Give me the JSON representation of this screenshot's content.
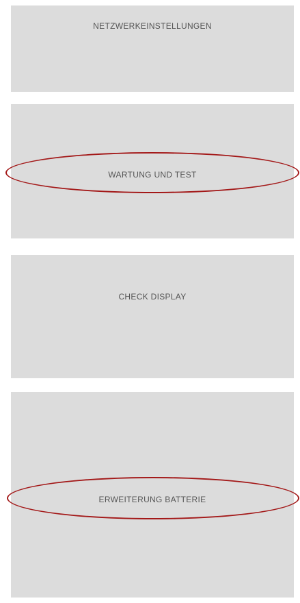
{
  "menu": {
    "items": [
      {
        "label": "NETZWERKEINSTELLUNGEN",
        "highlighted": false
      },
      {
        "label": "WARTUNG UND TEST",
        "highlighted": true
      },
      {
        "label": "CHECK DISPLAY",
        "highlighted": false
      },
      {
        "label": "ERWEITERUNG BATTERIE",
        "highlighted": true
      }
    ]
  },
  "colors": {
    "tile_background": "#dcdcdc",
    "label_text": "#555555",
    "highlight_ring": "#a31818"
  }
}
